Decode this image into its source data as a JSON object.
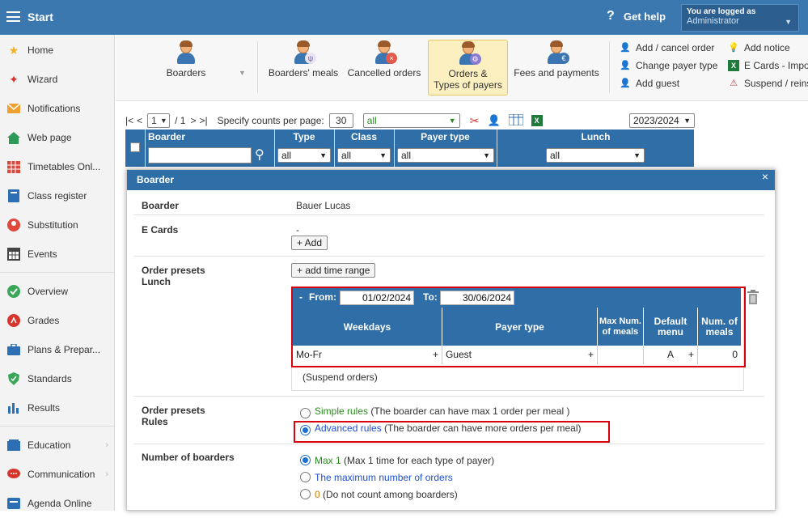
{
  "topbar": {
    "title": "Start",
    "help": "Get help",
    "help_icon": "?",
    "user_line1": "You are logged as",
    "user_line2": "Administrator"
  },
  "sidebar": {
    "items": [
      {
        "label": "Home",
        "icon": "star-icon"
      },
      {
        "label": "Wizard",
        "icon": "wand-icon"
      },
      {
        "label": "Notifications",
        "icon": "envelope-icon"
      },
      {
        "label": "Web page",
        "icon": "house-icon"
      },
      {
        "label": "Timetables Onl...",
        "icon": "timetable-icon"
      },
      {
        "label": "Class register",
        "icon": "book-icon"
      },
      {
        "label": "Substitution",
        "icon": "substitution-icon"
      },
      {
        "label": "Events",
        "icon": "calendar-icon"
      },
      {
        "label": "Overview",
        "icon": "check-circle-icon"
      },
      {
        "label": "Grades",
        "icon": "grades-icon"
      },
      {
        "label": "Plans & Prepar...",
        "icon": "briefcase-icon"
      },
      {
        "label": "Standards",
        "icon": "shield-icon"
      },
      {
        "label": "Results",
        "icon": "bar-chart-icon"
      },
      {
        "label": "Education",
        "icon": "education-icon"
      },
      {
        "label": "Communication",
        "icon": "chat-icon"
      },
      {
        "label": "Agenda Online",
        "icon": "agenda-icon"
      }
    ]
  },
  "toolbar": {
    "boarders": "Boarders",
    "boarders_meals": "Boarders' meals",
    "cancelled_orders": "Cancelled orders",
    "orders_l1": "Orders &",
    "orders_l2": "Types of payers",
    "fees": "Fees and payments",
    "add_cancel_order": "Add / cancel order",
    "change_payer_type": "Change payer type",
    "add_guest": "Add guest",
    "add_notice": "Add notice",
    "ecards_import": "E Cards - Impo",
    "suspend": "Suspend / reins"
  },
  "pager": {
    "first": "|<",
    "prev": "<",
    "page": "1",
    "of": "/ 1",
    "next": ">",
    "last": ">|",
    "counts_label": "Specify counts per page:",
    "counts": "30",
    "filter": "all",
    "year": "2023/2024"
  },
  "grid": {
    "headers": [
      "Boarder",
      "Type",
      "Class",
      "Payer type",
      "Lunch"
    ],
    "filters": [
      "all",
      "all",
      "all",
      "all"
    ]
  },
  "modal": {
    "title": "Boarder",
    "close": "×",
    "boarder_label": "Boarder",
    "boarder_value": "Bauer Lucas",
    "ecards_label": "E Cards",
    "ecards_value": "-",
    "add_btn": "+ Add",
    "presets_lunch_l1": "Order presets",
    "presets_lunch_l2": "Lunch",
    "add_time_range": "+ add time range",
    "range": {
      "minus": "-",
      "from_label": "From:",
      "from": "01/02/2024",
      "to_label": "To:",
      "to": "30/06/2024"
    },
    "cols": {
      "weekdays": "Weekdays",
      "payer": "Payer type",
      "max": "Max Num. of meals",
      "default": "Default menu",
      "num": "Num. of meals"
    },
    "row": {
      "weekdays": "Mo-Fr",
      "payer": "Guest",
      "max": "",
      "default": "A",
      "num": "0",
      "plus": "+"
    },
    "suspend": "(Suspend orders)",
    "presets_rules_l1": "Order presets",
    "presets_rules_l2": "Rules",
    "simple_name": "Simple rules",
    "simple_desc": " (The boarder can have max 1 order per meal )",
    "advanced_name": "Advanced rules",
    "advanced_desc": " (The boarder can have more orders per meal)",
    "nob_label": "Number of boarders",
    "max1_name": "Max 1",
    "max1_desc": " (Max 1 time for each type of payer)",
    "maxnum_name": "The maximum number of orders",
    "zero_name": "0",
    "zero_desc": " (Do not count among boarders)"
  }
}
